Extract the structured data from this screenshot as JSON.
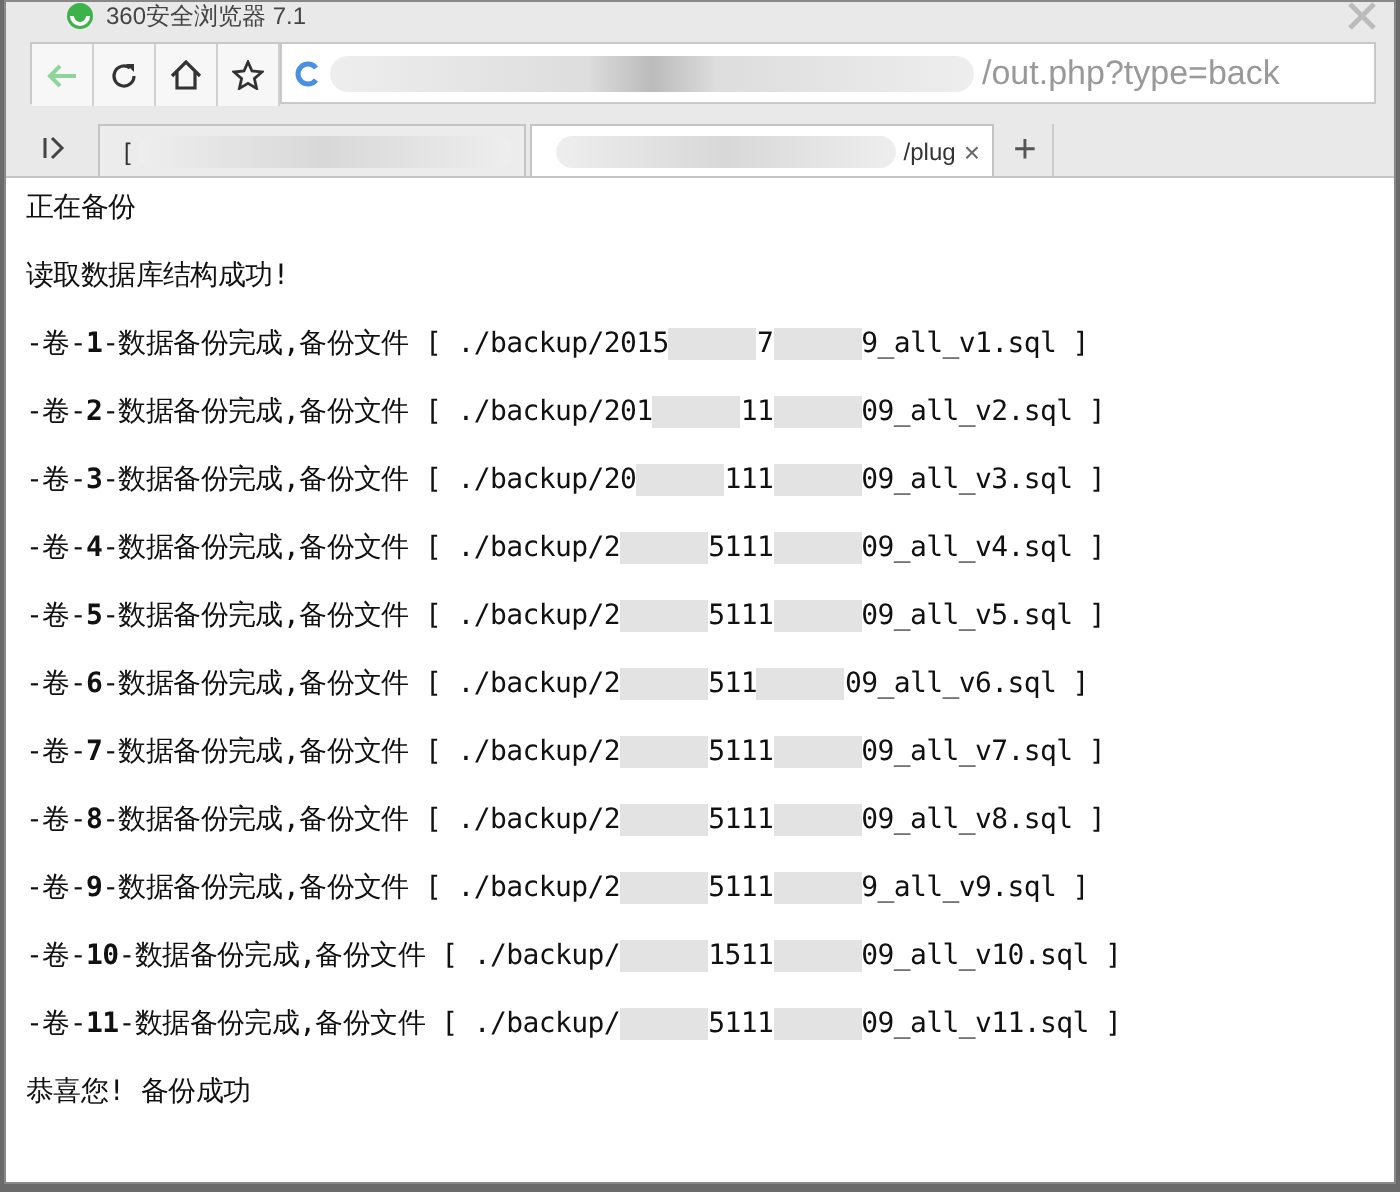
{
  "window": {
    "title": "360安全浏览器 7.1"
  },
  "address_bar": {
    "url_visible": "/out.php?type=back"
  },
  "tabs": [
    {
      "label": "[",
      "selected": false
    },
    {
      "label": "/plug",
      "selected": true,
      "close": "×"
    }
  ],
  "new_tab": "+",
  "lines": [
    {
      "kind": "text",
      "text": "正在备份"
    },
    {
      "kind": "text",
      "text": "读取数据库结构成功!"
    },
    {
      "kind": "volume",
      "head": "-卷-**1**-数据备份完成,备份文件 [ ",
      "path_parts": [
        "./backup/2015",
        "7",
        "9_all_v1.sql"
      ],
      "tail": " ]"
    },
    {
      "kind": "volume",
      "head": "-卷-**2**-数据备份完成,备份文件 [ ",
      "path_parts": [
        "./backup/201",
        "11",
        "09_all_v2.sql"
      ],
      "tail": " ]"
    },
    {
      "kind": "volume",
      "head": "-卷-**3**-数据备份完成,备份文件 [ ",
      "path_parts": [
        "./backup/20",
        "111",
        "09_all_v3.sql"
      ],
      "tail": " ]"
    },
    {
      "kind": "volume",
      "head": "-卷-**4**-数据备份完成,备份文件 [ ",
      "path_parts": [
        "./backup/2",
        "5111",
        "09_all_v4.sql"
      ],
      "tail": " ]"
    },
    {
      "kind": "volume",
      "head": "-卷-**5**-数据备份完成,备份文件 [ ",
      "path_parts": [
        "./backup/2",
        "5111",
        "09_all_v5.sql"
      ],
      "tail": " ]"
    },
    {
      "kind": "volume",
      "head": "-卷-**6**-数据备份完成,备份文件 [ ",
      "path_parts": [
        "./backup/2",
        "511",
        "09_all_v6.sql"
      ],
      "tail": " ]"
    },
    {
      "kind": "volume",
      "head": "-卷-**7**-数据备份完成,备份文件 [ ",
      "path_parts": [
        "./backup/2",
        "5111",
        "09_all_v7.sql"
      ],
      "tail": " ]"
    },
    {
      "kind": "volume",
      "head": "-卷-**8**-数据备份完成,备份文件 [ ",
      "path_parts": [
        "./backup/2",
        "5111",
        "09_all_v8.sql"
      ],
      "tail": " ]"
    },
    {
      "kind": "volume",
      "head": "-卷-**9**-数据备份完成,备份文件 [ ",
      "path_parts": [
        "./backup/2",
        "5111",
        "9_all_v9.sql"
      ],
      "tail": " ]"
    },
    {
      "kind": "volume",
      "head": "-卷-**10**-数据备份完成,备份文件 [ ",
      "path_parts": [
        "./backup/",
        "1511",
        "09_all_v10.sql"
      ],
      "tail": " ]"
    },
    {
      "kind": "volume",
      "head": "-卷-**11**-数据备份完成,备份文件 [ ",
      "path_parts": [
        "./backup/",
        "5111",
        "09_all_v11.sql"
      ],
      "tail": " ]"
    },
    {
      "kind": "text",
      "text": "恭喜您! 备份成功"
    }
  ]
}
